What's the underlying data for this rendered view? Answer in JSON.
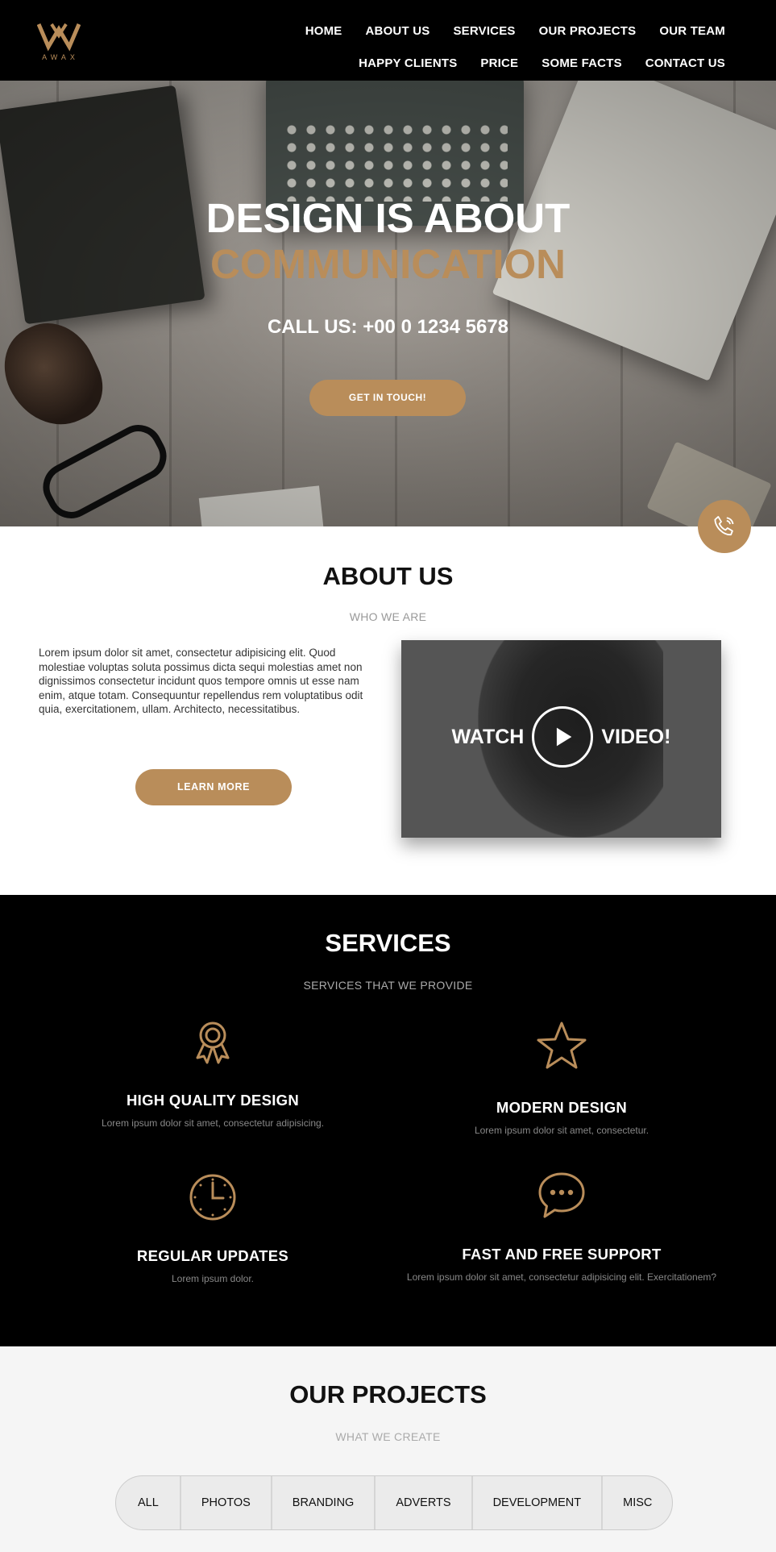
{
  "brand": {
    "logo_text": "AWAX",
    "accent": "#b98d5a"
  },
  "nav": {
    "row1": [
      "HOME",
      "ABOUT US",
      "SERVICES",
      "OUR PROJECTS",
      "OUR TEAM"
    ],
    "row2": [
      "HAPPY CLIENTS",
      "PRICE",
      "SOME FACTS",
      "CONTACT US"
    ]
  },
  "hero": {
    "title_line1": "DESIGN IS ABOUT",
    "title_line2": "COMMUNICATION",
    "call": "CALL US: +00 0 1234 5678",
    "button": "GET IN TOUCH!"
  },
  "fab": {
    "icon": "phone-icon"
  },
  "about": {
    "title": "ABOUT US",
    "subtitle": "WHO WE ARE",
    "text": "Lorem ipsum dolor sit amet, consectetur adipisicing elit. Quod molestiae voluptas soluta possimus dicta sequi molestias amet non dignissimos consectetur incidunt quos tempore omnis ut esse nam enim, atque totam. Consequuntur repellendus rem voluptatibus odit quia, exercitationem, ullam. Architecto, necessitatibus.",
    "button": "LEARN MORE",
    "video_left": "WATCH",
    "video_right": "VIDEO!"
  },
  "services": {
    "title": "SERVICES",
    "subtitle": "SERVICES THAT WE PROVIDE",
    "items": [
      {
        "icon": "award-icon",
        "title": "HIGH QUALITY DESIGN",
        "text": "Lorem ipsum dolor sit amet, consectetur adipisicing."
      },
      {
        "icon": "star-icon",
        "title": "MODERN DESIGN",
        "text": "Lorem ipsum dolor sit amet, consectetur."
      },
      {
        "icon": "clock-icon",
        "title": "REGULAR UPDATES",
        "text": "Lorem ipsum dolor."
      },
      {
        "icon": "chat-icon",
        "title": "FAST AND FREE SUPPORT",
        "text": "Lorem ipsum dolor sit amet, consectetur adipisicing elit. Exercitationem?"
      }
    ]
  },
  "projects": {
    "title": "OUR PROJECTS",
    "subtitle": "WHAT WE CREATE",
    "filters": [
      "ALL",
      "PHOTOS",
      "BRANDING",
      "ADVERTS",
      "DEVELOPMENT",
      "MISC"
    ]
  }
}
